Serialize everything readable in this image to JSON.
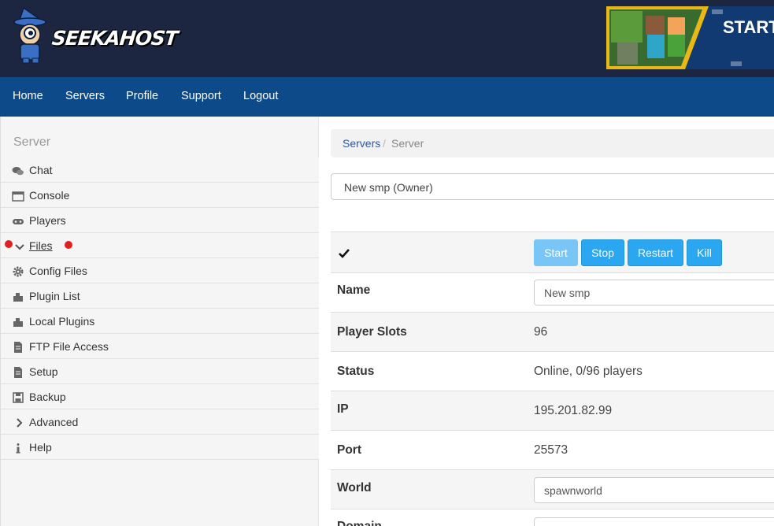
{
  "header": {
    "brand": "SEEKAHOST",
    "banner_text": "START"
  },
  "nav": {
    "items": [
      "Home",
      "Servers",
      "Profile",
      "Support",
      "Logout"
    ]
  },
  "sidebar": {
    "title": "Server",
    "items": [
      {
        "label": "Chat",
        "icon": "chat-icon"
      },
      {
        "label": "Console",
        "icon": "console-icon"
      },
      {
        "label": "Players",
        "icon": "gamepad-icon"
      },
      {
        "label": "Files",
        "icon": "chevron-down-icon"
      },
      {
        "label": "Config Files",
        "icon": "gear-icon"
      },
      {
        "label": "Plugin List",
        "icon": "puzzle-icon"
      },
      {
        "label": "Local Plugins",
        "icon": "puzzle-icon"
      },
      {
        "label": "FTP File Access",
        "icon": "file-icon"
      },
      {
        "label": "Setup",
        "icon": "file-icon"
      },
      {
        "label": "Backup",
        "icon": "save-icon"
      },
      {
        "label": "Advanced",
        "icon": "chevron-right-icon"
      },
      {
        "label": "Help",
        "icon": "info-icon"
      }
    ]
  },
  "breadcrumb": {
    "link": "Servers",
    "separator": "/",
    "current": "Server"
  },
  "server_select": {
    "value": "New smp (Owner)"
  },
  "controls": {
    "status_icon": "checkmark-icon",
    "buttons": [
      "Start",
      "Stop",
      "Restart",
      "Kill"
    ]
  },
  "details": {
    "name_label": "Name",
    "name_value": "New smp",
    "slots_label": "Player Slots",
    "slots_value": "96",
    "status_label": "Status",
    "status_value": "Online, 0/96 players",
    "ip_label": "IP",
    "ip_value": "195.201.82.99",
    "port_label": "Port",
    "port_value": "25573",
    "world_label": "World",
    "world_value": "spawnworld",
    "domain_label": "Domain"
  },
  "colors": {
    "header_bg": "#1c2640",
    "nav_bg": "#0d4a8a",
    "button": "#2aa7f0",
    "alert_dot": "#e0201e"
  }
}
